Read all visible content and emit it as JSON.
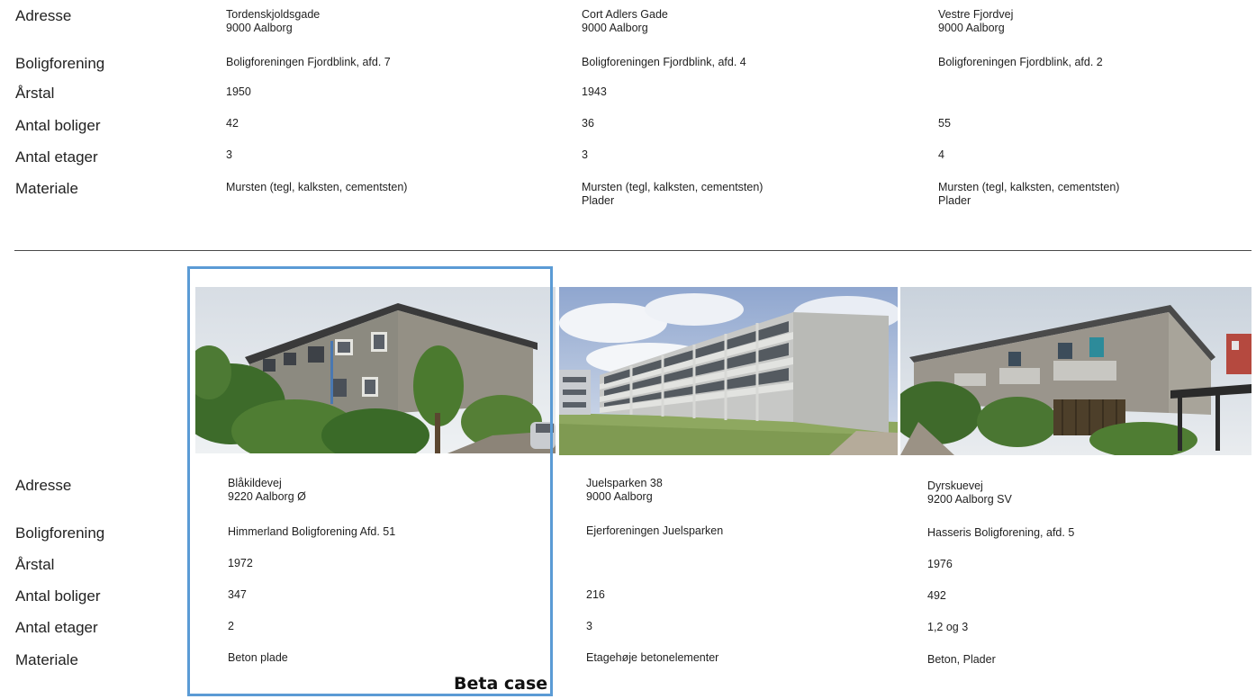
{
  "row_labels": {
    "address": "Adresse",
    "association": "Boligforening",
    "year": "Årstal",
    "dwellings": "Antal boliger",
    "floors": "Antal etager",
    "material": "Materiale"
  },
  "top_cases": [
    {
      "address_line1": "Tordenskjoldsgade",
      "address_line2": "9000 Aalborg",
      "association": "Boligforeningen Fjordblink, afd. 7",
      "year": "1950",
      "dwellings": "42",
      "floors": "3",
      "material_line1": "Mursten (tegl, kalksten, cementsten)",
      "material_line2": ""
    },
    {
      "address_line1": "Cort Adlers Gade",
      "address_line2": "9000 Aalborg",
      "association": "Boligforeningen Fjordblink, afd. 4",
      "year": "1943",
      "dwellings": "36",
      "floors": "3",
      "material_line1": "Mursten (tegl, kalksten, cementsten)",
      "material_line2": "Plader"
    },
    {
      "address_line1": "Vestre Fjordvej",
      "address_line2": "9000 Aalborg",
      "association": "Boligforeningen Fjordblink, afd. 2",
      "year": "",
      "dwellings": "55",
      "floors": "4",
      "material_line1": "Mursten (tegl, kalksten, cementsten)",
      "material_line2": "Plader"
    }
  ],
  "bottom_cases": [
    {
      "address_line1": "Blåkildevej",
      "address_line2": "9220 Aalborg Ø",
      "association": "Himmerland Boligforening Afd. 51",
      "year": "1972",
      "dwellings": "347",
      "floors": "2",
      "material": "Beton plade"
    },
    {
      "address_line1": "Juelsparken 38",
      "address_line2": "9000 Aalborg",
      "association": "Ejerforeningen Juelsparken",
      "year": "",
      "dwellings": "216",
      "floors": "3",
      "material": "Etagehøje betonelementer"
    },
    {
      "address_line1": "Dyrskuevej",
      "address_line2": "9200 Aalborg SV",
      "association": "Hasseris Boligforening, afd. 5",
      "year": "1976",
      "dwellings": "492",
      "floors": "1,2 og 3",
      "material": "Beton, Plader"
    }
  ],
  "highlight": {
    "label": "Beta case",
    "color": "#5b9bd5"
  },
  "photos": [
    {
      "name": "photo-blaakildevej"
    },
    {
      "name": "photo-juelsparken"
    },
    {
      "name": "photo-dyrskuevej"
    }
  ]
}
